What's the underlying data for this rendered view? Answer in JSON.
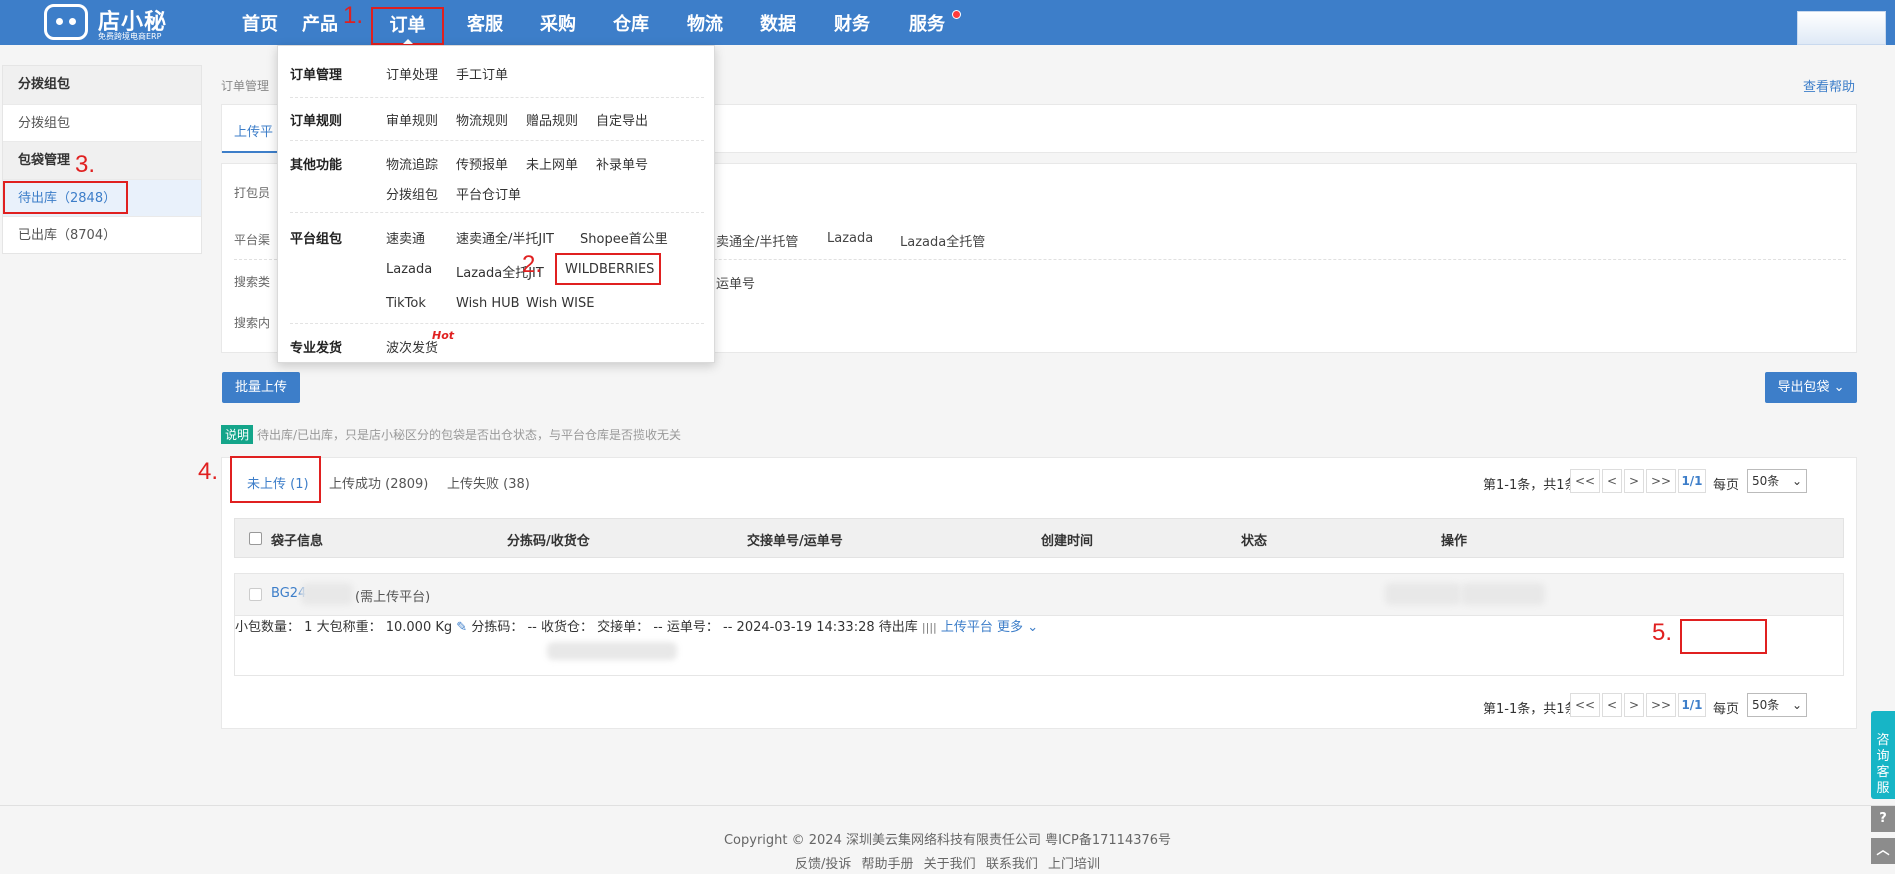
{
  "nav": {
    "logo_name": "店小秘",
    "logo_sub": "免费跨境电商ERP",
    "items": [
      "首页",
      "产品",
      "订单",
      "客服",
      "采购",
      "仓库",
      "物流",
      "数据",
      "财务",
      "服务"
    ]
  },
  "annotations": {
    "a1": "1.",
    "a2": "2.",
    "a3": "3.",
    "a4": "4.",
    "a5": "5."
  },
  "sidebar": {
    "groups": [
      {
        "title": "分拨组包",
        "items": [
          {
            "label": "分拨组包"
          }
        ]
      },
      {
        "title": "包袋管理",
        "items": [
          {
            "label": "待出库（2848）"
          },
          {
            "label": "已出库（8704）"
          }
        ]
      }
    ]
  },
  "breadcrumb": "订单管理",
  "help_link": "查看帮助",
  "tab_label": "上传平",
  "filter": {
    "labels": [
      "打包员",
      "平台渠",
      "搜索类",
      "搜索内"
    ],
    "platform_options": [
      "卖通全/半托管",
      "Lazada",
      "Lazada全托管"
    ],
    "search_type_fragment": "运单号"
  },
  "dropdown": {
    "rows": [
      {
        "category": "订单管理",
        "items": [
          "订单处理",
          "手工订单"
        ]
      },
      {
        "category": "订单规则",
        "items": [
          "审单规则",
          "物流规则",
          "赠品规则",
          "自定导出"
        ]
      },
      {
        "category": "其他功能",
        "items": [
          "物流追踪",
          "传预报单",
          "未上网单",
          "补录单号",
          "分拨组包",
          "平台仓订单"
        ]
      },
      {
        "category": "平台组包",
        "items": [
          "速卖通",
          "速卖通全/半托JIT",
          "Shopee首公里",
          "Lazada",
          "Lazada全托JIT",
          "WILDBERRIES",
          "TikTok",
          "Wish HUB",
          "Wish WISE"
        ]
      },
      {
        "category": "专业发货",
        "items": [
          "波次发货"
        ],
        "hot": "Hot"
      }
    ]
  },
  "buttons": {
    "batch_upload": "批量上传",
    "export": "导出包袋"
  },
  "tip": {
    "badge": "说明",
    "text": "待出库/已出库，只是店小秘区分的包袋是否出仓状态，与平台仓库是否揽收无关"
  },
  "status_tabs": [
    "未上传 (1)",
    "上传成功 (2809)",
    "上传失败 (38)"
  ],
  "pager": {
    "summary": "第1-1条，共1条",
    "first": "<<",
    "prev": "<",
    "next": ">",
    "last": ">>",
    "page": "1/1",
    "per_page_label": "每页",
    "per_page": "50条"
  },
  "table": {
    "headers": [
      "袋子信息",
      "分拣码/收货仓",
      "交接单号/运单号",
      "创建时间",
      "状态",
      "操作"
    ],
    "row": {
      "bag_no": "BG24",
      "bag_note": "(需上传平台)",
      "small_count_label": "小包数量：",
      "small_count": "1",
      "weight_label": "大包称重：",
      "weight": "10.000 Kg",
      "sort_code_label": "分拣码：",
      "sort_code": "--",
      "warehouse_label": "收货仓：",
      "handover_label": "交接单：",
      "handover": "--",
      "waybill_label": "运单号：",
      "waybill": "--",
      "created": "2024-03-19 14:33:28",
      "status": "待出库",
      "action_upload": "上传平台",
      "action_more": "更多"
    }
  },
  "footer": {
    "copyright": "Copyright © 2024 深圳美云集网络科技有限责任公司  粤ICP备17114376号",
    "links": [
      "反馈/投诉",
      "帮助手册",
      "关于我们",
      "联系我们",
      "上门培训"
    ]
  },
  "consult": "咨询客服"
}
